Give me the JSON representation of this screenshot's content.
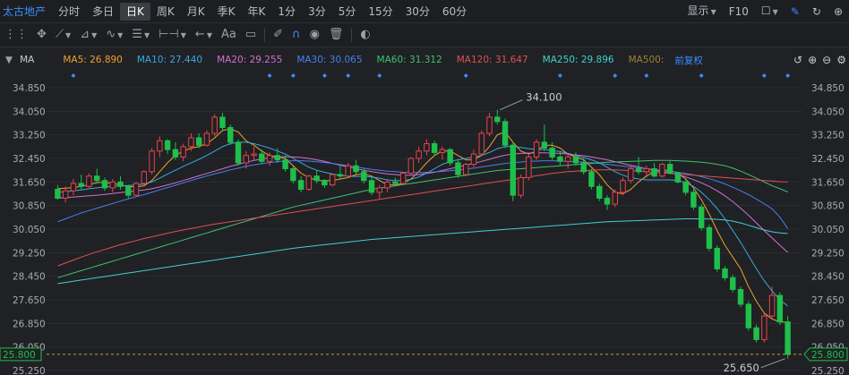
{
  "header": {
    "title": "太古地产",
    "periods": [
      "分时",
      "多日",
      "日K",
      "周K",
      "月K",
      "季K",
      "年K",
      "1分",
      "3分",
      "5分",
      "15分",
      "30分",
      "60分"
    ],
    "active_period": "日K",
    "display_label": "显示",
    "f10_label": "F10"
  },
  "toolbar": {
    "text_tool": "Aa"
  },
  "indicator_bar": {
    "label": "MA",
    "items": [
      {
        "text": "MA5: 26.890",
        "color": "#f0a030"
      },
      {
        "text": "MA10: 27.440",
        "color": "#3aa8e0"
      },
      {
        "text": "MA20: 29.255",
        "color": "#d070d0"
      },
      {
        "text": "MA30: 30.065",
        "color": "#4a7ff0"
      },
      {
        "text": "MA60: 31.312",
        "color": "#40c070"
      },
      {
        "text": "MA120: 31.647",
        "color": "#e05050"
      },
      {
        "text": "MA250: 29.896",
        "color": "#40d0d0"
      },
      {
        "text": "MA500:",
        "color": "#a08030"
      }
    ],
    "adjust_label": "前复权"
  },
  "chart_data": {
    "type": "candlestick",
    "y_ticks": [
      "34.850",
      "34.050",
      "33.250",
      "32.450",
      "31.650",
      "30.850",
      "30.050",
      "29.250",
      "28.450",
      "27.650",
      "26.850",
      "26.050",
      "25.250"
    ],
    "ylim": [
      25.25,
      34.85
    ],
    "last_price": "25.800",
    "annotations": [
      {
        "text": "34.100",
        "kind": "high"
      },
      {
        "text": "25.650",
        "kind": "low"
      }
    ],
    "up_color": "#e8434a",
    "down_color": "#1fbf4c",
    "candles": [
      [
        31.4,
        31.55,
        31.05,
        31.1
      ],
      [
        31.1,
        31.5,
        30.95,
        31.35
      ],
      [
        31.35,
        31.75,
        31.2,
        31.6
      ],
      [
        31.6,
        31.9,
        31.4,
        31.5
      ],
      [
        31.5,
        31.95,
        31.45,
        31.85
      ],
      [
        31.85,
        32.1,
        31.6,
        31.7
      ],
      [
        31.7,
        31.8,
        31.35,
        31.45
      ],
      [
        31.45,
        31.75,
        31.3,
        31.65
      ],
      [
        31.65,
        31.85,
        31.4,
        31.5
      ],
      [
        31.5,
        31.55,
        31.1,
        31.2
      ],
      [
        31.2,
        31.65,
        31.15,
        31.6
      ],
      [
        31.6,
        32.05,
        31.55,
        32.0
      ],
      [
        32.0,
        32.8,
        31.9,
        32.7
      ],
      [
        32.7,
        33.2,
        32.5,
        33.05
      ],
      [
        33.05,
        33.1,
        32.6,
        32.75
      ],
      [
        32.75,
        33.0,
        32.4,
        32.5
      ],
      [
        32.5,
        32.95,
        32.35,
        32.85
      ],
      [
        32.85,
        33.3,
        32.7,
        33.15
      ],
      [
        33.15,
        33.3,
        32.8,
        32.9
      ],
      [
        32.9,
        33.4,
        32.85,
        33.3
      ],
      [
        33.3,
        33.95,
        33.2,
        33.85
      ],
      [
        33.85,
        34.0,
        33.4,
        33.5
      ],
      [
        33.5,
        33.6,
        32.9,
        33.0
      ],
      [
        33.0,
        33.1,
        32.2,
        32.3
      ],
      [
        32.3,
        32.7,
        32.1,
        32.55
      ],
      [
        32.55,
        32.85,
        32.4,
        32.6
      ],
      [
        32.6,
        32.75,
        32.25,
        32.35
      ],
      [
        32.35,
        32.65,
        32.2,
        32.55
      ],
      [
        32.55,
        32.8,
        32.3,
        32.4
      ],
      [
        32.4,
        32.55,
        32.0,
        32.1
      ],
      [
        32.1,
        32.2,
        31.6,
        31.7
      ],
      [
        31.7,
        31.85,
        31.3,
        31.4
      ],
      [
        31.4,
        31.9,
        31.35,
        31.85
      ],
      [
        31.85,
        32.05,
        31.6,
        31.7
      ],
      [
        31.7,
        31.75,
        31.45,
        31.55
      ],
      [
        31.55,
        31.95,
        31.5,
        31.9
      ],
      [
        31.9,
        32.2,
        31.75,
        31.85
      ],
      [
        31.85,
        32.3,
        31.8,
        32.2
      ],
      [
        32.2,
        32.4,
        31.9,
        32.0
      ],
      [
        32.0,
        32.1,
        31.6,
        31.7
      ],
      [
        31.7,
        31.8,
        31.2,
        31.3
      ],
      [
        31.3,
        31.55,
        31.05,
        31.45
      ],
      [
        31.45,
        31.75,
        31.3,
        31.65
      ],
      [
        31.65,
        31.8,
        31.5,
        31.6
      ],
      [
        31.6,
        32.0,
        31.55,
        31.95
      ],
      [
        31.95,
        32.5,
        31.9,
        32.45
      ],
      [
        32.45,
        32.85,
        32.3,
        32.7
      ],
      [
        32.7,
        33.1,
        32.55,
        32.95
      ],
      [
        32.95,
        33.05,
        32.55,
        32.65
      ],
      [
        32.65,
        32.85,
        32.4,
        32.75
      ],
      [
        32.75,
        32.8,
        32.2,
        32.3
      ],
      [
        32.3,
        32.4,
        31.8,
        31.9
      ],
      [
        31.9,
        32.3,
        31.85,
        32.25
      ],
      [
        32.25,
        32.75,
        32.15,
        32.6
      ],
      [
        32.6,
        33.4,
        32.55,
        33.3
      ],
      [
        33.3,
        34.0,
        33.2,
        33.85
      ],
      [
        33.85,
        34.1,
        33.6,
        33.7
      ],
      [
        33.7,
        33.8,
        32.8,
        32.9
      ],
      [
        32.9,
        33.0,
        31.0,
        31.2
      ],
      [
        31.2,
        31.9,
        31.1,
        31.8
      ],
      [
        31.8,
        32.6,
        31.7,
        32.5
      ],
      [
        32.5,
        33.1,
        32.4,
        33.0
      ],
      [
        33.0,
        33.6,
        32.7,
        32.8
      ],
      [
        32.8,
        33.0,
        32.4,
        32.5
      ],
      [
        32.5,
        32.7,
        32.2,
        32.35
      ],
      [
        32.35,
        32.6,
        32.1,
        32.5
      ],
      [
        32.5,
        32.65,
        32.2,
        32.3
      ],
      [
        32.3,
        32.45,
        31.9,
        32.0
      ],
      [
        32.0,
        32.1,
        31.4,
        31.5
      ],
      [
        31.5,
        31.6,
        31.0,
        31.1
      ],
      [
        31.1,
        31.2,
        30.7,
        30.9
      ],
      [
        30.9,
        31.4,
        30.8,
        31.3
      ],
      [
        31.3,
        31.8,
        31.2,
        31.7
      ],
      [
        31.7,
        32.2,
        31.6,
        32.1
      ],
      [
        32.1,
        32.5,
        31.9,
        32.0
      ],
      [
        32.0,
        32.2,
        31.8,
        32.1
      ],
      [
        32.1,
        32.3,
        31.8,
        31.85
      ],
      [
        31.85,
        32.3,
        31.8,
        32.25
      ],
      [
        32.25,
        32.35,
        31.9,
        31.95
      ],
      [
        31.95,
        32.0,
        31.6,
        31.65
      ],
      [
        31.65,
        31.75,
        31.2,
        31.3
      ],
      [
        31.3,
        31.4,
        30.7,
        30.8
      ],
      [
        30.8,
        30.9,
        30.0,
        30.1
      ],
      [
        30.1,
        30.2,
        29.3,
        29.4
      ],
      [
        29.4,
        29.5,
        28.6,
        28.7
      ],
      [
        28.7,
        28.8,
        28.3,
        28.4
      ],
      [
        28.4,
        28.5,
        27.9,
        28.0
      ],
      [
        28.0,
        28.1,
        27.4,
        27.5
      ],
      [
        27.5,
        27.6,
        26.6,
        26.7
      ],
      [
        26.7,
        26.8,
        26.2,
        26.3
      ],
      [
        26.3,
        27.2,
        26.2,
        27.1
      ],
      [
        27.1,
        28.1,
        27.0,
        27.8
      ],
      [
        27.8,
        27.9,
        26.8,
        26.9
      ],
      [
        26.9,
        27.1,
        25.65,
        25.8
      ]
    ],
    "ma_values": {
      "MA5": [
        31.42,
        31.44,
        31.46,
        31.5,
        31.56,
        31.63,
        31.64,
        31.6,
        31.55,
        31.5,
        31.48,
        31.52,
        31.7,
        32.0,
        32.3,
        32.55,
        32.7,
        32.8,
        32.85,
        32.95,
        33.15,
        33.4,
        33.45,
        33.35,
        33.05,
        32.9,
        32.7,
        32.55,
        32.5,
        32.45,
        32.2,
        31.95,
        31.8,
        31.7,
        31.7,
        31.7,
        31.75,
        31.8,
        31.9,
        31.92,
        31.85,
        31.7,
        31.55,
        31.55,
        31.6,
        31.75,
        32.0,
        32.3,
        32.55,
        32.7,
        32.7,
        32.55,
        32.4,
        32.4,
        32.55,
        32.85,
        33.25,
        33.35,
        33.0,
        32.7,
        32.6,
        32.7,
        32.9,
        32.9,
        32.8,
        32.6,
        32.5,
        32.4,
        32.15,
        31.9,
        31.55,
        31.3,
        31.25,
        31.4,
        31.65,
        31.85,
        32.0,
        32.05,
        32.05,
        31.95,
        31.75,
        31.45,
        31.05,
        30.55,
        30.0,
        29.5,
        29.1,
        28.7,
        28.1,
        27.6,
        27.2,
        27.0,
        26.9,
        26.89
      ],
      "MA10": [
        31.3,
        31.32,
        31.35,
        31.38,
        31.42,
        31.45,
        31.48,
        31.5,
        31.52,
        31.53,
        31.55,
        31.58,
        31.65,
        31.78,
        31.92,
        32.05,
        32.18,
        32.3,
        32.42,
        32.55,
        32.7,
        32.85,
        32.95,
        33.0,
        33.0,
        32.95,
        32.88,
        32.8,
        32.7,
        32.6,
        32.45,
        32.3,
        32.15,
        32.05,
        31.98,
        31.92,
        31.88,
        31.85,
        31.84,
        31.84,
        31.82,
        31.78,
        31.72,
        31.7,
        31.7,
        31.74,
        31.82,
        31.95,
        32.1,
        32.25,
        32.35,
        32.4,
        32.45,
        32.5,
        32.55,
        32.65,
        32.78,
        32.85,
        32.85,
        32.82,
        32.78,
        32.75,
        32.75,
        32.72,
        32.68,
        32.62,
        32.55,
        32.48,
        32.4,
        32.3,
        32.15,
        32.0,
        31.88,
        31.8,
        31.75,
        31.72,
        31.72,
        31.72,
        31.72,
        31.7,
        31.62,
        31.5,
        31.3,
        31.05,
        30.75,
        30.4,
        30.0,
        29.6,
        29.15,
        28.7,
        28.3,
        27.95,
        27.65,
        27.44
      ],
      "MA20": [
        31.1,
        31.12,
        31.14,
        31.16,
        31.18,
        31.2,
        31.23,
        31.26,
        31.29,
        31.32,
        31.35,
        31.38,
        31.42,
        31.48,
        31.55,
        31.62,
        31.7,
        31.78,
        31.86,
        31.94,
        32.02,
        32.1,
        32.18,
        32.25,
        32.32,
        32.38,
        32.43,
        32.47,
        32.5,
        32.51,
        32.5,
        32.48,
        32.45,
        32.4,
        32.35,
        32.28,
        32.22,
        32.16,
        32.1,
        32.05,
        32.0,
        31.96,
        31.92,
        31.9,
        31.88,
        31.88,
        31.9,
        31.94,
        31.98,
        32.04,
        32.1,
        32.16,
        32.22,
        32.28,
        32.35,
        32.42,
        32.5,
        32.56,
        32.6,
        32.62,
        32.63,
        32.64,
        32.64,
        32.63,
        32.62,
        32.6,
        32.57,
        32.54,
        32.5,
        32.45,
        32.4,
        32.34,
        32.28,
        32.22,
        32.16,
        32.1,
        32.05,
        32.0,
        31.95,
        31.9,
        31.82,
        31.73,
        31.62,
        31.5,
        31.35,
        31.18,
        30.98,
        30.76,
        30.52,
        30.26,
        30.0,
        29.75,
        29.5,
        29.26
      ],
      "MA30": [
        30.3,
        30.4,
        30.5,
        30.6,
        30.68,
        30.76,
        30.84,
        30.92,
        31.0,
        31.08,
        31.15,
        31.22,
        31.3,
        31.38,
        31.46,
        31.54,
        31.62,
        31.7,
        31.78,
        31.85,
        31.92,
        31.99,
        32.06,
        32.12,
        32.18,
        32.23,
        32.27,
        32.31,
        32.34,
        32.36,
        32.37,
        32.37,
        32.36,
        32.34,
        32.31,
        32.28,
        32.24,
        32.2,
        32.16,
        32.12,
        32.08,
        32.05,
        32.02,
        32.0,
        31.98,
        31.97,
        31.97,
        31.98,
        31.99,
        32.01,
        32.03,
        32.06,
        32.09,
        32.12,
        32.16,
        32.2,
        32.24,
        32.28,
        32.31,
        32.33,
        32.35,
        32.36,
        32.37,
        32.37,
        32.36,
        32.35,
        32.34,
        32.32,
        32.3,
        32.28,
        32.25,
        32.22,
        32.19,
        32.16,
        32.13,
        32.1,
        32.07,
        32.04,
        32.01,
        31.98,
        31.94,
        31.89,
        31.83,
        31.76,
        31.68,
        31.58,
        31.47,
        31.35,
        31.22,
        31.07,
        30.91,
        30.74,
        30.45,
        30.07
      ],
      "MA60": [
        28.4,
        28.48,
        28.56,
        28.64,
        28.72,
        28.8,
        28.88,
        28.96,
        29.04,
        29.12,
        29.2,
        29.28,
        29.36,
        29.44,
        29.52,
        29.6,
        29.68,
        29.76,
        29.84,
        29.92,
        30.0,
        30.08,
        30.16,
        30.24,
        30.32,
        30.4,
        30.48,
        30.56,
        30.64,
        30.72,
        30.8,
        30.86,
        30.92,
        30.98,
        31.04,
        31.1,
        31.16,
        31.22,
        31.28,
        31.34,
        31.4,
        31.44,
        31.48,
        31.52,
        31.56,
        31.6,
        31.64,
        31.68,
        31.72,
        31.76,
        31.8,
        31.84,
        31.88,
        31.92,
        31.96,
        32.0,
        32.04,
        32.06,
        32.08,
        32.1,
        32.12,
        32.14,
        32.16,
        32.18,
        32.2,
        32.22,
        32.24,
        32.26,
        32.28,
        32.3,
        32.32,
        32.33,
        32.34,
        32.35,
        32.36,
        32.37,
        32.38,
        32.38,
        32.38,
        32.37,
        32.36,
        32.34,
        32.32,
        32.29,
        32.25,
        32.2,
        32.12,
        32.02,
        31.9,
        31.78,
        31.65,
        31.52,
        31.42,
        31.31
      ],
      "MA120": [
        28.8,
        28.9,
        29.0,
        29.1,
        29.19,
        29.28,
        29.36,
        29.44,
        29.52,
        29.59,
        29.66,
        29.73,
        29.79,
        29.85,
        29.91,
        29.97,
        30.02,
        30.07,
        30.12,
        30.17,
        30.22,
        30.26,
        30.3,
        30.34,
        30.38,
        30.42,
        30.46,
        30.5,
        30.54,
        30.58,
        30.62,
        30.66,
        30.7,
        30.74,
        30.78,
        30.82,
        30.86,
        30.9,
        30.94,
        30.98,
        31.02,
        31.06,
        31.1,
        31.14,
        31.18,
        31.22,
        31.26,
        31.3,
        31.34,
        31.38,
        31.42,
        31.46,
        31.5,
        31.54,
        31.58,
        31.62,
        31.66,
        31.7,
        31.74,
        31.78,
        31.82,
        31.86,
        31.9,
        31.94,
        31.97,
        32.0,
        32.02,
        32.04,
        32.05,
        32.06,
        32.06,
        32.06,
        32.05,
        32.04,
        32.02,
        32.0,
        31.98,
        31.96,
        31.94,
        31.92,
        31.9,
        31.88,
        31.86,
        31.84,
        31.82,
        31.8,
        31.78,
        31.76,
        31.74,
        31.72,
        31.7,
        31.68,
        31.66,
        31.65
      ],
      "MA250": [
        28.2,
        28.24,
        28.28,
        28.32,
        28.36,
        28.4,
        28.44,
        28.48,
        28.52,
        28.56,
        28.6,
        28.64,
        28.68,
        28.72,
        28.76,
        28.8,
        28.84,
        28.88,
        28.92,
        28.96,
        29.0,
        29.04,
        29.08,
        29.12,
        29.16,
        29.2,
        29.24,
        29.28,
        29.32,
        29.36,
        29.4,
        29.43,
        29.46,
        29.49,
        29.52,
        29.55,
        29.58,
        29.61,
        29.64,
        29.67,
        29.7,
        29.72,
        29.74,
        29.76,
        29.78,
        29.8,
        29.82,
        29.84,
        29.86,
        29.88,
        29.9,
        29.92,
        29.94,
        29.96,
        29.98,
        30.0,
        30.02,
        30.04,
        30.06,
        30.08,
        30.1,
        30.12,
        30.14,
        30.16,
        30.18,
        30.2,
        30.22,
        30.24,
        30.26,
        30.28,
        30.3,
        30.31,
        30.32,
        30.33,
        30.34,
        30.35,
        30.36,
        30.37,
        30.38,
        30.39,
        30.4,
        30.4,
        30.4,
        30.39,
        30.38,
        30.36,
        30.32,
        30.26,
        30.18,
        30.1,
        30.02,
        29.96,
        29.92,
        29.9
      ]
    }
  }
}
